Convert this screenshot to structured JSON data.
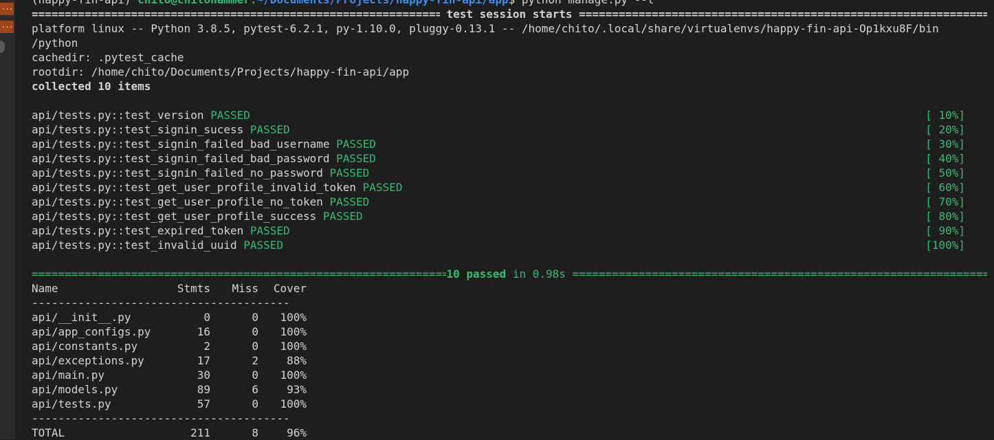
{
  "gutter": {
    "markers": [
      "...",
      "..."
    ]
  },
  "prompt": {
    "env": "(happy-fin-api)",
    "user_host": "chito@chitohammer:",
    "path": "~/Documents/Projects/happy-fin-api/app",
    "command": "$ python manage.py --t"
  },
  "session": {
    "header": " test session starts ",
    "platform": "platform linux -- Python 3.8.5, pytest-6.2.1, py-1.10.0, pluggy-0.13.1 -- /home/chito/.local/share/virtualenvs/happy-fin-api-Op1kxu8F/bin",
    "platform_cont": "/python",
    "cachedir": "cachedir: .pytest_cache",
    "rootdir": "rootdir: /home/chito/Documents/Projects/happy-fin-api/app",
    "collected": "collected 10 items"
  },
  "tests": [
    {
      "name": "api/tests.py::test_version",
      "status": "PASSED",
      "pct": "[ 10%]"
    },
    {
      "name": "api/tests.py::test_signin_sucess",
      "status": "PASSED",
      "pct": "[ 20%]"
    },
    {
      "name": "api/tests.py::test_signin_failed_bad_username",
      "status": "PASSED",
      "pct": "[ 30%]"
    },
    {
      "name": "api/tests.py::test_signin_failed_bad_password",
      "status": "PASSED",
      "pct": "[ 40%]"
    },
    {
      "name": "api/tests.py::test_signin_failed_no_password",
      "status": "PASSED",
      "pct": "[ 50%]"
    },
    {
      "name": "api/tests.py::test_get_user_profile_invalid_token",
      "status": "PASSED",
      "pct": "[ 60%]"
    },
    {
      "name": "api/tests.py::test_get_user_profile_no_token",
      "status": "PASSED",
      "pct": "[ 70%]"
    },
    {
      "name": "api/tests.py::test_get_user_profile_success",
      "status": "PASSED",
      "pct": "[ 80%]"
    },
    {
      "name": "api/tests.py::test_expired_token",
      "status": "PASSED",
      "pct": "[ 90%]"
    },
    {
      "name": "api/tests.py::test_invalid_uuid",
      "status": "PASSED",
      "pct": "[100%]"
    }
  ],
  "summary": {
    "passed": "10 passed",
    "in": " in 0.98s "
  },
  "coverage": {
    "headers": [
      "Name",
      "Stmts",
      "Miss",
      "Cover"
    ],
    "divider": "---------------------------------------",
    "rows": [
      [
        "api/__init__.py",
        "0",
        "0",
        "100%"
      ],
      [
        "api/app_configs.py",
        "16",
        "0",
        "100%"
      ],
      [
        "api/constants.py",
        "2",
        "0",
        "100%"
      ],
      [
        "api/exceptions.py",
        "17",
        "2",
        "88%"
      ],
      [
        "api/main.py",
        "30",
        "0",
        "100%"
      ],
      [
        "api/models.py",
        "89",
        "6",
        "93%"
      ],
      [
        "api/tests.py",
        "57",
        "0",
        "100%"
      ]
    ],
    "total": [
      "TOTAL",
      "211",
      "8",
      "96%"
    ]
  },
  "colors": {
    "background": "#1e1e1e",
    "text": "#d4d4d4",
    "pass": "#2fbf71",
    "path": "#3b8eea"
  }
}
